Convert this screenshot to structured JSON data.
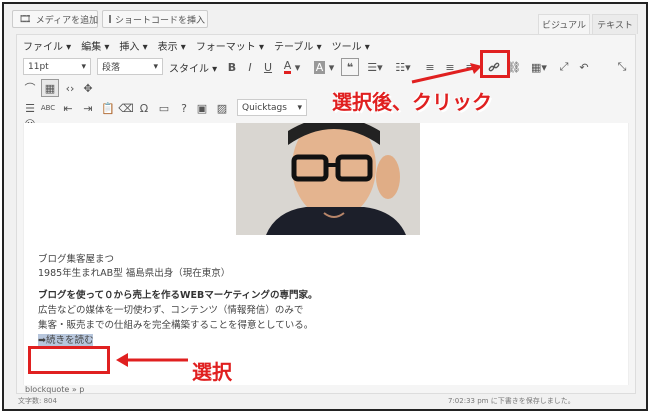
{
  "media_row": {
    "add_media_label": "メディアを追加",
    "add_shortcode_label": "ショートコードを挿入",
    "tab_visual": "ビジュアル",
    "tab_text": "テキスト"
  },
  "menubar": {
    "items": [
      "ファイル ▾",
      "編集 ▾",
      "挿入 ▾",
      "表示 ▾",
      "フォーマット ▾",
      "テーブル ▾",
      "ツール ▾"
    ]
  },
  "toolbar1": {
    "font_size": "11pt",
    "paragraph": "段落",
    "style": "スタイル ▾"
  },
  "toolbar3": {
    "quicktags": "Quicktags"
  },
  "content": {
    "line1": "ブログ集客屋まつ",
    "line2": "1985年生まれAB型 福島県出身（現在東京）",
    "line3": "ブログを使って０から売上を作るWEBマーケティングの専門家。",
    "line4": "広告などの媒体を一切使わず、コンテンツ（情報発信）のみで",
    "line5": "集客・販売までの仕組みを完全構築することを得意としている。",
    "read_more": "➡続きを読む"
  },
  "status": {
    "path": "blockquote » p",
    "word_count": "文字数: 804",
    "saved": "7:02:33 pm に下書きを保存しました。"
  },
  "annotations": {
    "click_note": "選択後、クリック",
    "select_note": "選択"
  },
  "colors": {
    "annotation_red": "#e02020"
  }
}
